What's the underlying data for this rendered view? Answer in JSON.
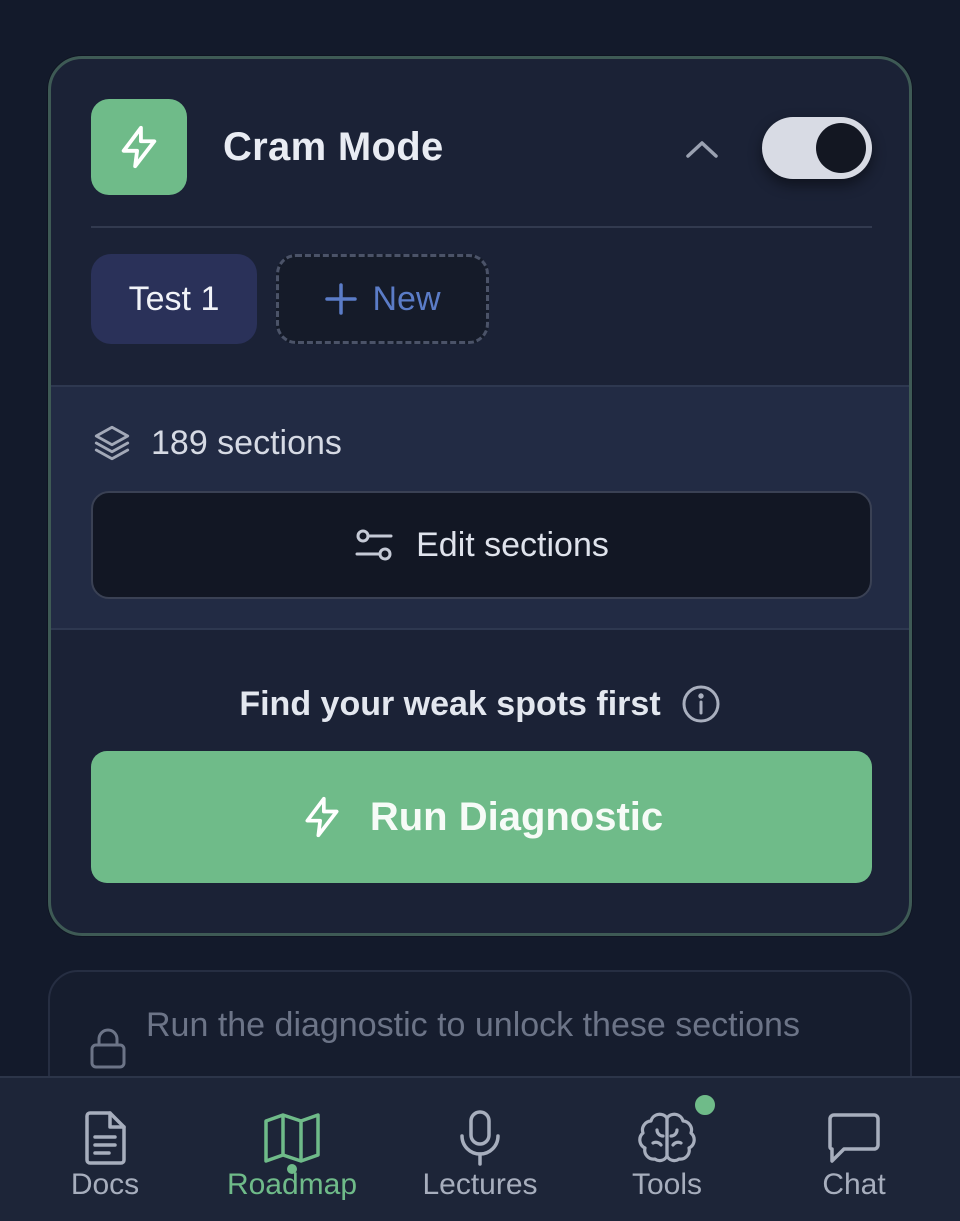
{
  "cram_card": {
    "title": "Cram Mode",
    "icon": "lightning-icon",
    "collapse_icon": "chevron-up-icon",
    "toggle_on": true,
    "accent_color": "#6fbb89"
  },
  "tests": {
    "chips": [
      {
        "label": "Test 1",
        "selected": true
      }
    ],
    "new_label": "New"
  },
  "sections": {
    "count_text": "189 sections",
    "icon": "layers-icon",
    "edit_label": "Edit sections",
    "edit_icon": "sliders-icon"
  },
  "diagnostic": {
    "prompt": "Find your weak spots first",
    "info_icon": "info-icon",
    "run_label": "Run Diagnostic"
  },
  "locked": {
    "text": "Run the diagnostic to unlock these sections",
    "icon": "lock-icon"
  },
  "nav": {
    "items": [
      {
        "label": "Docs",
        "icon": "document-icon"
      },
      {
        "label": "Roadmap",
        "icon": "map-icon",
        "active": true
      },
      {
        "label": "Lectures",
        "icon": "microphone-icon"
      },
      {
        "label": "Tools",
        "icon": "brain-icon",
        "badge": true
      },
      {
        "label": "Chat",
        "icon": "chat-bubble-icon"
      }
    ]
  }
}
